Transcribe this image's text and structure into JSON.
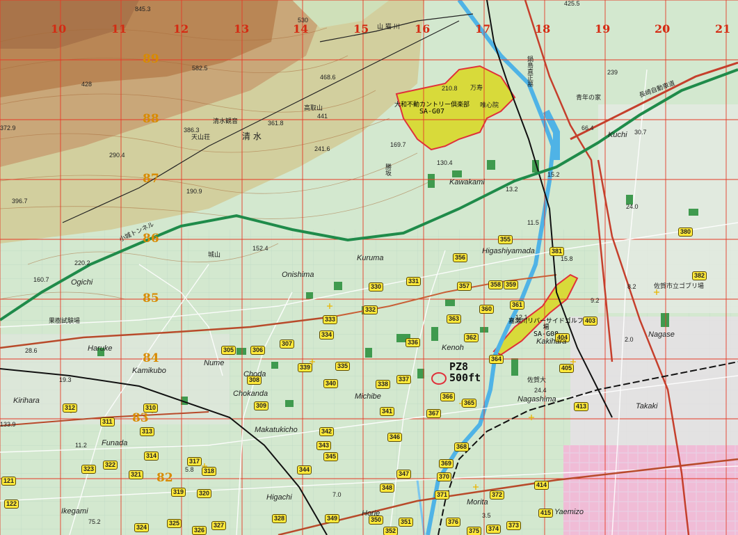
{
  "grid": {
    "columns": [
      "10",
      "11",
      "12",
      "13",
      "14",
      "15",
      "16",
      "17",
      "18",
      "19",
      "20",
      "21"
    ],
    "rows": [
      "89",
      "88",
      "87",
      "86",
      "85",
      "84",
      "83",
      "82"
    ]
  },
  "golf": [
    {
      "name": "大和不動カントリー倶楽部",
      "code": "SA-G07"
    },
    {
      "name": "嘉瀬川リバーサイドゴルフ場",
      "code": "SA-G08"
    }
  ],
  "pz": {
    "id": "PZ8",
    "alt": "500ft"
  },
  "waypoints": [
    "305",
    "306",
    "307",
    "308",
    "309",
    "310",
    "311",
    "312",
    "313",
    "314",
    "317",
    "318",
    "319",
    "320",
    "321",
    "322",
    "323",
    "324",
    "325",
    "326",
    "327",
    "328",
    "330",
    "331",
    "332",
    "333",
    "334",
    "335",
    "336",
    "337",
    "338",
    "339",
    "340",
    "341",
    "342",
    "343",
    "344",
    "345",
    "346",
    "347",
    "348",
    "349",
    "350",
    "351",
    "352",
    "355",
    "356",
    "357",
    "358",
    "359",
    "360",
    "361",
    "362",
    "363",
    "364",
    "365",
    "366",
    "367",
    "368",
    "369",
    "370",
    "371",
    "372",
    "373",
    "374",
    "375",
    "376",
    "380",
    "381",
    "382",
    "403",
    "404",
    "405",
    "413",
    "414",
    "415",
    "121",
    "122"
  ],
  "places": [
    "Kuruma",
    "Onishima",
    "Kawakami",
    "Higashiyamada",
    "Kenoh",
    "Kakihara",
    "Choda",
    "Chokanda",
    "Michibe",
    "Takaki",
    "Kamikubo",
    "Funada",
    "Ikegami",
    "Horie",
    "Morita",
    "Yaemizo",
    "Nagashima",
    "Kirihara",
    "Nume",
    "Haruke",
    "Ogichi",
    "Kuchi",
    "Higachi",
    "Makatukicho",
    "Nagase"
  ],
  "jp_labels": [
    "山 猫 川",
    "万寿",
    "鍋島直正墓",
    "青年の家",
    "清水観音",
    "清 水",
    "高取山",
    "天山荘",
    "勝坂",
    "城山",
    "小城トンネル",
    "果樹試験場",
    "佐賀市立ゴブリ場",
    "佐賀大",
    "唯心院",
    "長崎自動車道"
  ],
  "elevations": [
    "845.3",
    "530",
    "425.5",
    "582.5",
    "468.6",
    "210.8",
    "428",
    "372.9",
    "386.3",
    "361.8",
    "441",
    "239",
    "290.4",
    "241.6",
    "169.7",
    "130.4",
    "396.7",
    "190.9",
    "152.4",
    "220.2",
    "160.7",
    "19.3",
    "133.9",
    "11.2",
    "5.8",
    "7.0",
    "3.5",
    "75.2",
    "28.6",
    "66.4",
    "30.7",
    "24.0",
    "15.2",
    "13.2",
    "12.1",
    "15.8",
    "11.5",
    "9.2",
    "2.0",
    "8.2",
    "24.4"
  ]
}
